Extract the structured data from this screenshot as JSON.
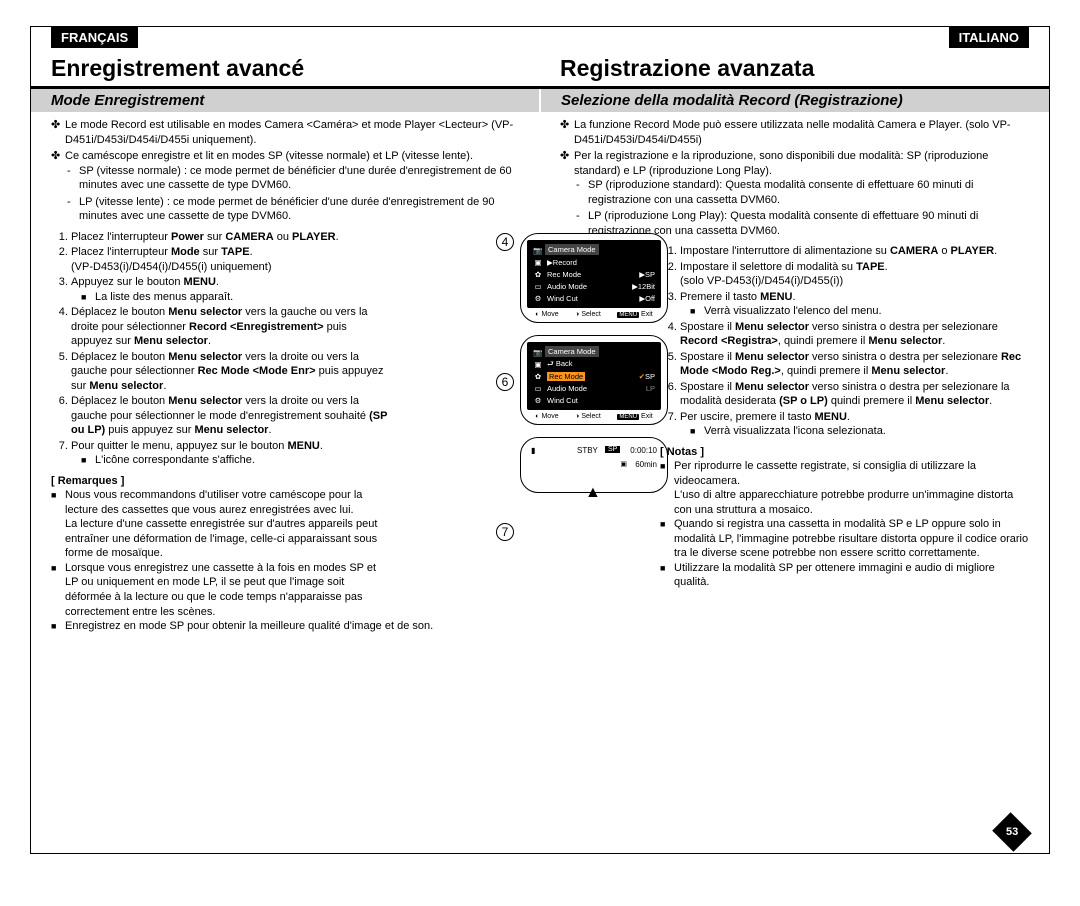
{
  "lang_left": "FRANÇAIS",
  "lang_right": "ITALIANO",
  "title_left": "Enregistrement avancé",
  "title_right": "Registrazione avanzata",
  "subtitle_left": "Mode Enregistrement",
  "subtitle_right": "Selezione della modalità Record (Registrazione)",
  "fr": {
    "b1": "Le mode Record est utilisable en modes Camera <Caméra> et mode Player <Lecteur> (VP-D451i/D453i/D454i/D455i uniquement).",
    "b2": "Ce caméscope enregistre et lit en modes SP (vitesse normale) et LP (vitesse lente).",
    "b2a": "SP (vitesse normale) : ce mode permet de bénéficier d'une durée d'enregistrement de 60 minutes avec une cassette de type DVM60.",
    "b2b": "LP (vitesse lente) : ce mode permet de bénéficier d'une durée d'enregistrement de 90 minutes avec une cassette de type DVM60.",
    "s1a": "Placez l'interrupteur ",
    "s1b": " sur ",
    "s1c": " ou ",
    "s2a": "Placez l'interrupteur ",
    "s2b": " sur ",
    "s2c": "(VP-D453(i)/D454(i)/D455(i) uniquement)",
    "s3a": "Appuyez sur le bouton ",
    "s3sub": "La liste des menus apparaît.",
    "s4a": "Déplacez le bouton ",
    "s4b": " vers la gauche ou vers la droite pour sélectionner ",
    "s4c": " puis appuyez sur ",
    "s5a": "Déplacez le bouton ",
    "s5b": " vers la droite ou vers la gauche pour sélectionner ",
    "s5c": " puis appuyez sur ",
    "s6a": "Déplacez le bouton ",
    "s6b": " vers la droite ou vers la gauche pour sélectionner le mode d'enregistrement souhaité ",
    "s6c": " puis appuyez sur ",
    "s7a": "Pour quitter le menu, appuyez sur le bouton ",
    "s7sub": "L'icône correspondante s'affiche.",
    "notes_h": "[ Remarques ]",
    "n1": "Nous vous recommandons d'utiliser votre caméscope pour la lecture des cassettes que vous aurez enregistrées avec lui.",
    "n1b": "La lecture d'une cassette enregistrée sur d'autres appareils peut entraîner une déformation de l'image, celle-ci apparaissant sous forme de mosaïque.",
    "n2": "Lorsque vous enregistrez une cassette à la fois en modes SP et LP ou uniquement en mode LP, il se peut que l'image soit déformée à la lecture ou que le code temps n'apparaisse pas correctement entre les scènes.",
    "n3": "Enregistrez en mode SP pour obtenir la meilleure qualité d'image et de son.",
    "power": "Power",
    "camera": "CAMERA",
    "player": "PLAYER",
    "mode": "Mode",
    "tape": "TAPE",
    "menu": "MENU",
    "menusel": "Menu selector",
    "recenr": "Record <Enregistrement>",
    "recmode": "Rec Mode <Mode Enr>",
    "splp": "(SP ou LP)"
  },
  "it": {
    "b1": "La funzione Record Mode può essere utilizzata nelle modalità Camera e Player. (solo VP-D451i/D453i/D454i/D455i)",
    "b2": "Per la registrazione e la riproduzione, sono disponibili due modalità: SP (riproduzione standard) e LP (riproduzione Long Play).",
    "b2a": "SP (riproduzione standard): Questa modalità consente di effettuare 60 minuti di registrazione con una cassetta DVM60.",
    "b2b": "LP (riproduzione Long Play): Questa modalità consente di effettuare 90 minuti di registrazione con una cassetta DVM60.",
    "s1a": "Impostare l'interruttore di alimentazione su ",
    "s1b": " o ",
    "s2a": "Impostare il selettore di modalità su ",
    "s2b": "(solo VP-D453(i)/D454(i)/D455(i))",
    "s3a": "Premere il tasto ",
    "s3sub": "Verrà visualizzato l'elenco del menu.",
    "s4a": "Spostare il ",
    "s4b": " verso sinistra o destra per selezionare ",
    "s4c": ", quindi premere il ",
    "s5a": "Spostare il ",
    "s5b": " verso sinistra o destra per selezionare ",
    "s5c": ", quindi premere il ",
    "s6a": "Spostare il ",
    "s6b": " verso sinistra o destra per selezionare la modalità desiderata ",
    "s6c": " quindi premere il ",
    "s7a": "Per uscire, premere il tasto ",
    "s7sub": "Verrà visualizzata l'icona selezionata.",
    "notes_h": "[ Notas ]",
    "n1": "Per riprodurre le cassette registrate, si consiglia di utilizzare la videocamera.",
    "n1b": "L'uso di altre apparecchiature potrebbe produrre un'immagine distorta con una struttura a mosaico.",
    "n2": "Quando si registra una cassetta in modalità SP e LP oppure solo in modalità LP, l'immagine potrebbe risultare distorta oppure il codice orario tra le diverse scene potrebbe non essere scritto correttamente.",
    "n3": "Utilizzare la modalità SP per ottenere immagini e audio di migliore qualità.",
    "camera": "CAMERA",
    "player": "PLAYER",
    "tape": "TAPE",
    "menu": "MENU",
    "menusel": "Menu selector",
    "recreg": "Record <Registra>",
    "recmode": "Rec Mode <Modo Reg.>",
    "splp": "(SP o LP)"
  },
  "osd": {
    "title": "Camera Mode",
    "record": "Record",
    "recmode": "Rec Mode",
    "audio": "Audio Mode",
    "wind": "Wind Cut",
    "sp": "SP",
    "lp": "LP",
    "b12": "12Bit",
    "off": "Off",
    "back": "Back",
    "move": "Move",
    "select": "Select",
    "exit": "Exit",
    "menukey": "MENU",
    "stby": "STBY",
    "tc": "0:00:10",
    "rem": "60min",
    "spbadge": "SP"
  },
  "fig": {
    "n4": "4",
    "n6": "6",
    "n7": "7"
  },
  "page_number": "53"
}
